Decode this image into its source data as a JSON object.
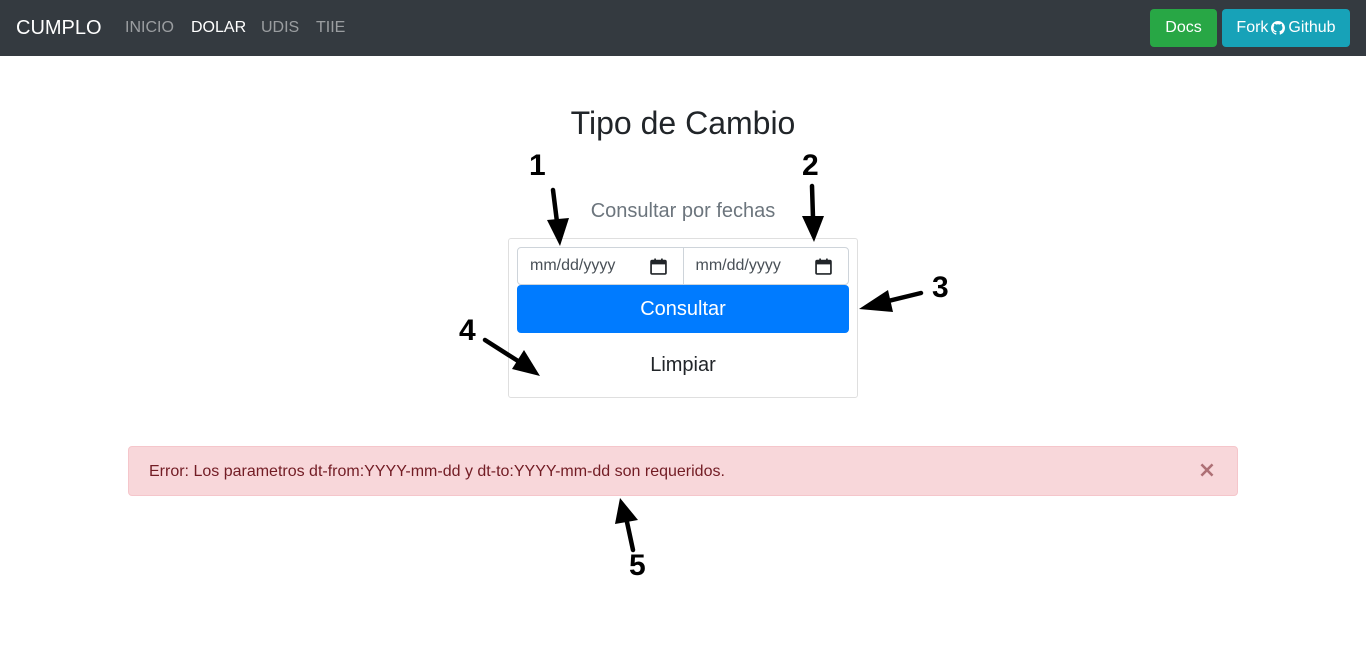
{
  "navbar": {
    "brand": "CUMPLO",
    "links": [
      {
        "label": "INICIO",
        "active": false
      },
      {
        "label": "DOLAR",
        "active": true
      },
      {
        "label": "UDIS",
        "active": false
      },
      {
        "label": "TIIE",
        "active": false
      }
    ],
    "docs_label": "Docs",
    "fork_label_pre": "Fork",
    "fork_label_post": "Github",
    "fork_icon": "github-icon"
  },
  "main": {
    "title": "Tipo de Cambio",
    "subtitle": "Consultar por fechas",
    "date_from": {
      "placeholder": "mm/dd/yyyy",
      "icon": "calendar-icon"
    },
    "date_to": {
      "placeholder": "mm/dd/yyyy",
      "icon": "calendar-icon"
    },
    "submit_label": "Consultar",
    "clear_label": "Limpiar"
  },
  "alert": {
    "message": "Error: Los parametros dt-from:YYYY-mm-dd y dt-to:YYYY-mm-dd son requeridos.",
    "close_label": "×"
  },
  "annotations": [
    "1",
    "2",
    "3",
    "4",
    "5"
  ],
  "colors": {
    "navbar_bg": "#343a40",
    "docs_button": "#28a745",
    "fork_button": "#17a2b8",
    "primary": "#007bff",
    "alert_bg": "#f8d7da",
    "alert_text": "#721c24"
  }
}
